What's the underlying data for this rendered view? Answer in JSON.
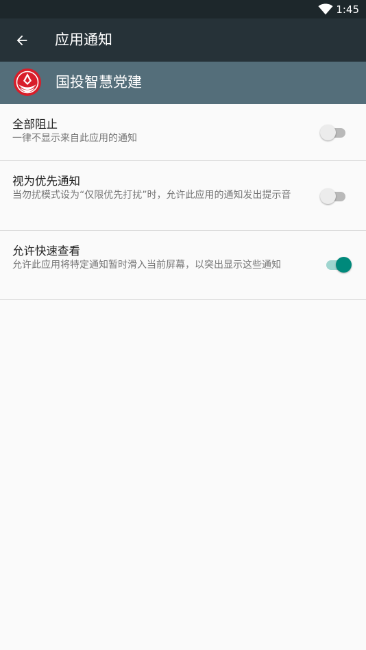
{
  "status_bar": {
    "time": "1:45",
    "wifi_icon": "wifi-icon"
  },
  "toolbar": {
    "title": "应用通知",
    "back_icon": "arrow-back-icon"
  },
  "app": {
    "name": "国投智慧党建",
    "logo_icon": "app-logo-icon",
    "brand_color": "#d81e2a"
  },
  "settings": [
    {
      "label": "全部阻止",
      "summary": "一律不显示来自此应用的通知",
      "enabled": false
    },
    {
      "label": "视为优先通知",
      "summary": "当勿扰模式设为“仅限优先打扰”时，允许此应用的通知发出提示音",
      "enabled": false
    },
    {
      "label": "允许快速查看",
      "summary": "允许此应用将特定通知暂时滑入当前屏幕，以突出显示这些通知",
      "enabled": true
    }
  ],
  "colors": {
    "status_bar": "#1d272b",
    "toolbar": "#263238",
    "app_header": "#546e7a",
    "accent": "#00897b"
  }
}
